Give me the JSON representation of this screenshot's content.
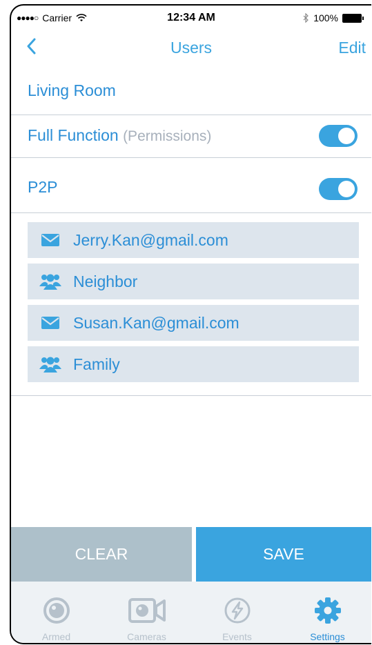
{
  "status_bar": {
    "carrier": "Carrier",
    "time": "12:34 AM",
    "battery": "100%"
  },
  "nav": {
    "title": "Users",
    "edit": "Edit"
  },
  "location": "Living Room",
  "full_function": {
    "label": "Full Function",
    "sub": "(Permissions)",
    "enabled": true
  },
  "p2p": {
    "label": "P2P",
    "enabled": true
  },
  "users": [
    {
      "type": "email",
      "icon": "envelope-icon",
      "label": "Jerry.Kan@gmail.com"
    },
    {
      "type": "group",
      "icon": "group-icon",
      "label": "Neighbor"
    },
    {
      "type": "email",
      "icon": "envelope-icon",
      "label": "Susan.Kan@gmail.com"
    },
    {
      "type": "group",
      "icon": "group-icon",
      "label": "Family"
    }
  ],
  "actions": {
    "clear": "CLEAR",
    "save": "SAVE"
  },
  "tabs": [
    {
      "label": "Armed",
      "icon": "armed-icon",
      "active": false
    },
    {
      "label": "Cameras",
      "icon": "camera-icon",
      "active": false
    },
    {
      "label": "Events",
      "icon": "events-icon",
      "active": false
    },
    {
      "label": "Settings",
      "icon": "settings-gear-icon",
      "active": true
    }
  ],
  "colors": {
    "accent": "#3aa4df",
    "text_blue": "#2b8ed6",
    "clear_bg": "#adc0ca",
    "list_bg": "#dde5ed",
    "inactive": "#b6c1cb"
  }
}
